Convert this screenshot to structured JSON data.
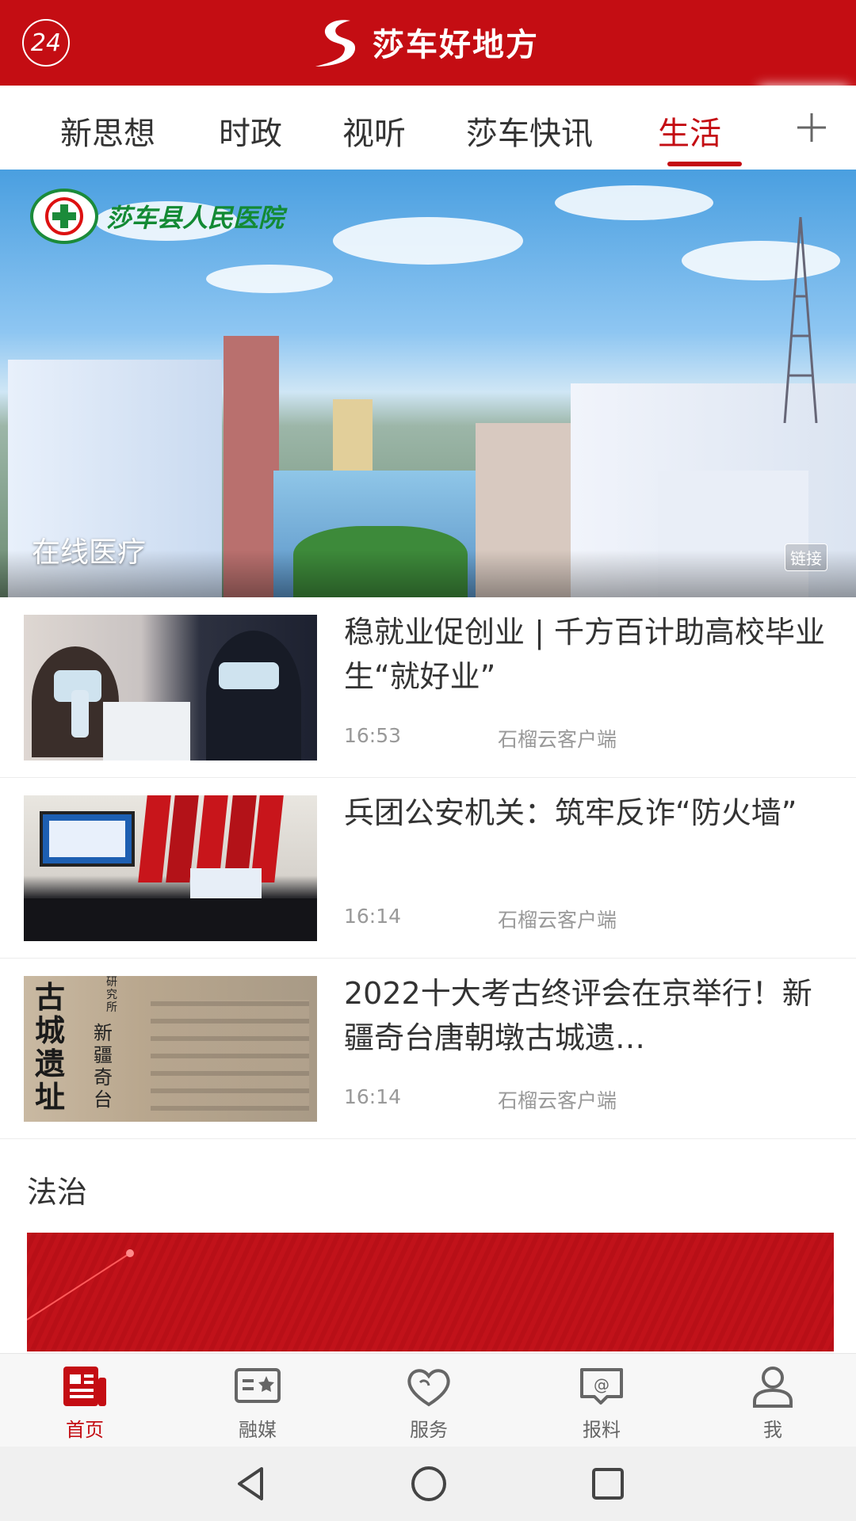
{
  "header": {
    "badge": "24",
    "title": "莎车好地方"
  },
  "tabs": [
    {
      "label": "新思想",
      "active": false
    },
    {
      "label": "时政",
      "active": false
    },
    {
      "label": "视听",
      "active": false
    },
    {
      "label": "莎车快讯",
      "active": false
    },
    {
      "label": "生活",
      "active": true
    }
  ],
  "tabs_more_icon": "plus-icon",
  "banner": {
    "logo_text": "莎车县人民医院",
    "caption": "在线医疗",
    "link_badge": "链接"
  },
  "news": [
    {
      "title": "稳就业促创业 | 千方百计助高校毕业生“就好业”",
      "time": "16:53",
      "source": "石榴云客户端"
    },
    {
      "title": "兵团公安机关：筑牢反诈“防火墙”",
      "time": "16:14",
      "source": "石榴云客户端"
    },
    {
      "title": "2022十大考古终评会在京举行！新疆奇台唐朝墩古城遗…",
      "time": "16:14",
      "source": "石榴云客户端"
    }
  ],
  "thumb3_text": {
    "left": "古城遗址",
    "right": "新疆奇台",
    "top": "研究所"
  },
  "section": {
    "title": "法治"
  },
  "bottom_nav": [
    {
      "label": "首页",
      "icon": "news-icon",
      "active": true
    },
    {
      "label": "融媒",
      "icon": "media-icon",
      "active": false
    },
    {
      "label": "服务",
      "icon": "heart-icon",
      "active": false
    },
    {
      "label": "报料",
      "icon": "chat-at-icon",
      "active": false
    },
    {
      "label": "我",
      "icon": "user-icon",
      "active": false
    }
  ],
  "colors": {
    "brand": "#c40d13",
    "text": "#333333",
    "muted": "#999999"
  }
}
